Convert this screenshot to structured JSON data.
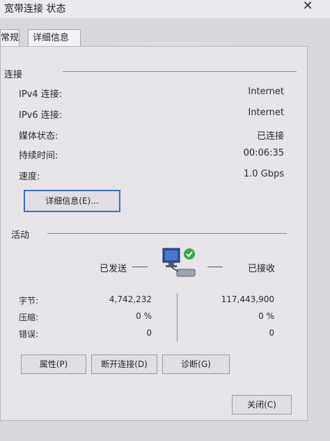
{
  "window": {
    "title": "宽带连接 状态"
  },
  "tabs": [
    {
      "label": "常规"
    },
    {
      "label": "详细信息"
    }
  ],
  "connection": {
    "section_label": "连接",
    "rows": [
      {
        "label": "IPv4 连接:",
        "value": "Internet"
      },
      {
        "label": "IPv6 连接:",
        "value": "Internet"
      },
      {
        "label": "媒体状态:",
        "value": "已连接"
      },
      {
        "label": "持续时间:",
        "value": "00:06:35"
      },
      {
        "label": "速度:",
        "value": "1.0 Gbps"
      }
    ],
    "details_button": "详细信息(E)..."
  },
  "activity": {
    "section_label": "活动",
    "sent_label": "已发送",
    "received_label": "已接收",
    "rows": [
      {
        "label": "字节:",
        "sent": "4,742,232",
        "received": "117,443,900"
      },
      {
        "label": "压缩:",
        "sent": "0 %",
        "received": "0 %"
      },
      {
        "label": "错误:",
        "sent": "0",
        "received": "0"
      }
    ]
  },
  "buttons": {
    "properties": "属性(P)",
    "disconnect": "断开连接(D)",
    "diagnose": "诊断(G)",
    "close": "关闭(C)"
  }
}
